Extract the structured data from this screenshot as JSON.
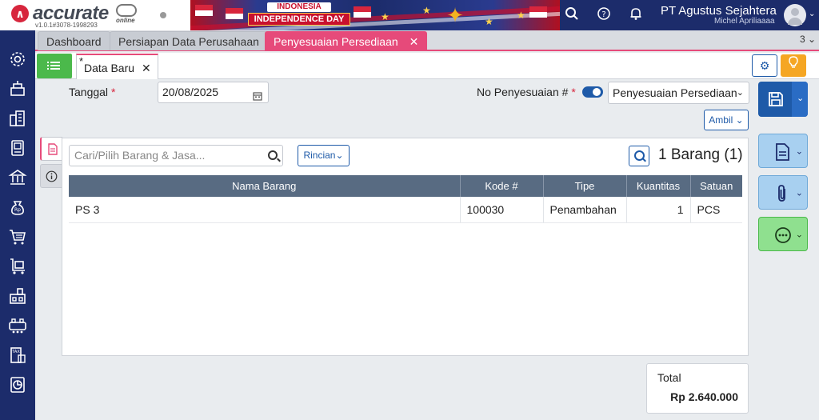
{
  "app": {
    "brand": "accurate",
    "brand_sub": "online",
    "version": "v1.0.1#3078-1998293"
  },
  "banner": {
    "line1": "INDONESIA",
    "line2": "INDEPENDENCE DAY"
  },
  "header": {
    "company": "PT Agustus Sejahtera",
    "user": "Michel Apriliaaaa",
    "icons": [
      "search-icon",
      "help-icon",
      "bell-icon",
      "avatar"
    ]
  },
  "sidebar": {
    "icons": [
      "settings-icon",
      "company-icon",
      "building-icon",
      "ledger-icon",
      "bank-icon",
      "money-bag-icon",
      "cart-icon",
      "trolley-icon",
      "warehouse-icon",
      "production-icon",
      "tax-icon",
      "report-icon"
    ]
  },
  "tabs": {
    "items": [
      {
        "label": "Dashboard"
      },
      {
        "label": "Persiapan Data Perusahaan"
      },
      {
        "label": "Penyesuaian Persediaan",
        "close": "✕"
      }
    ],
    "count": "3 ⌄"
  },
  "subtab": {
    "modified_marker": "*",
    "label": "Data Baru",
    "close": "✕"
  },
  "form": {
    "tanggal_label": "Tanggal",
    "required_mark": "*",
    "tanggal_value": "20/08/2025",
    "no_label": "No Penyesuaian #",
    "no_select_value": "Penyesuaian Persediaan",
    "ambil_label": "Ambil"
  },
  "items": {
    "search_placeholder": "Cari/Pilih Barang & Jasa...",
    "rincian_label": "Rincian",
    "count_text": "1 Barang (1)",
    "columns": [
      "Nama Barang",
      "Kode #",
      "Tipe",
      "Kuantitas",
      "Satuan"
    ],
    "rows": [
      {
        "nama": "PS 3",
        "kode": "100030",
        "tipe": "Penambahan",
        "qty": "1",
        "satuan": "PCS"
      }
    ]
  },
  "total": {
    "label": "Total",
    "value": "Rp 2.640.000"
  },
  "colors": {
    "navy": "#1c2c6b",
    "accent_pink": "#e64a7a",
    "primary_blue": "#1e5aa8",
    "green": "#4bb94b",
    "orange": "#f5a623"
  }
}
